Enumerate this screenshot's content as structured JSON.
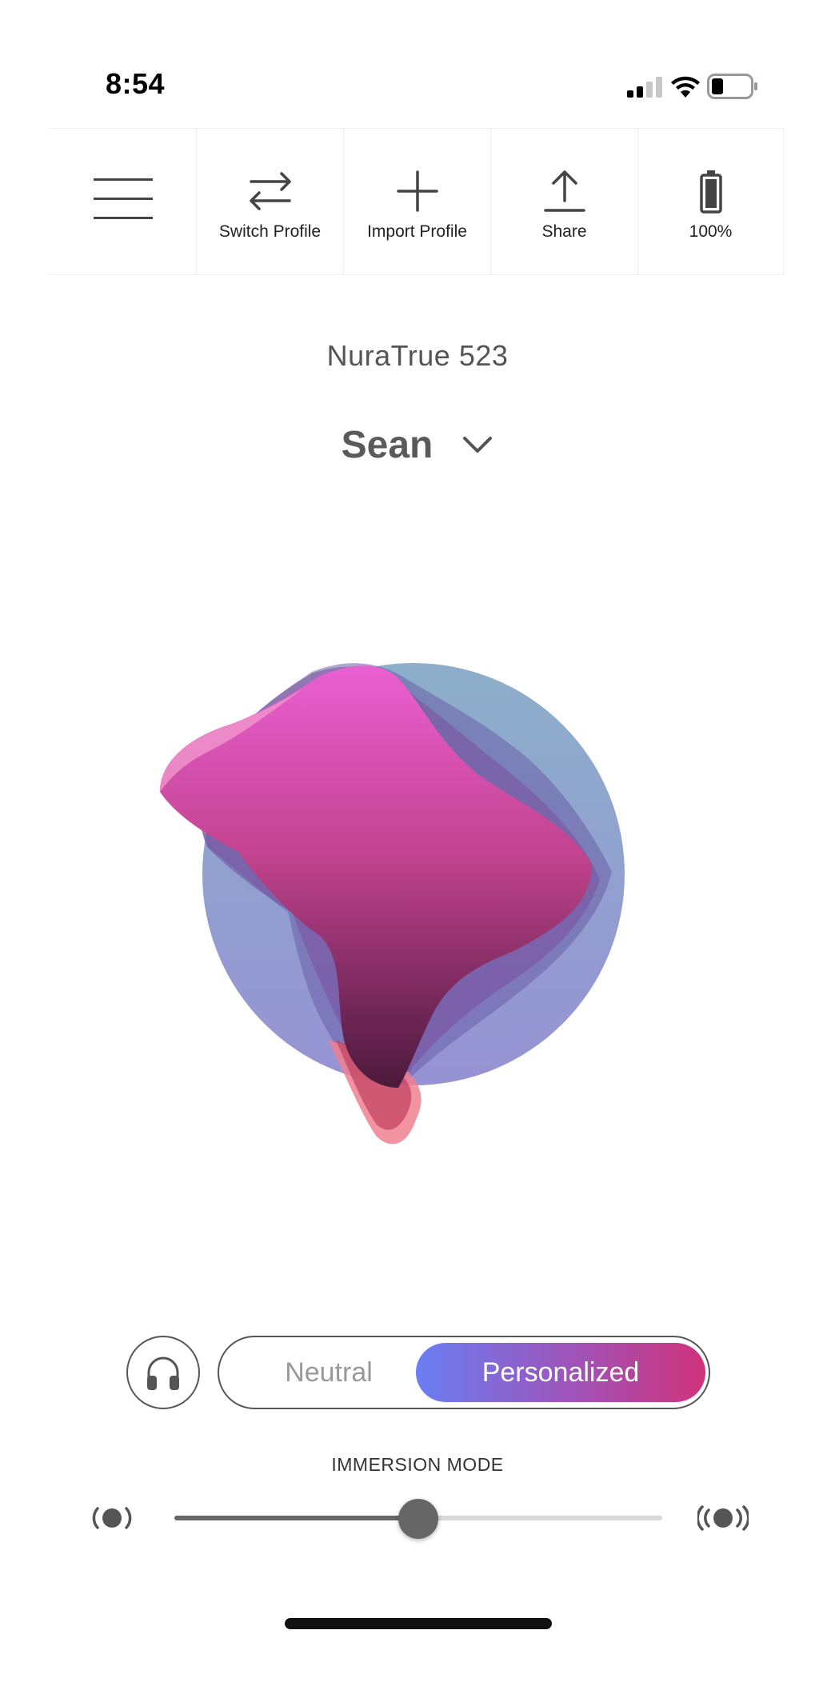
{
  "status_bar": {
    "time": "8:54",
    "signal_icon": "cellular-signal-icon",
    "wifi_icon": "wifi-icon",
    "battery_icon": "battery-icon"
  },
  "toolbar": {
    "menu_icon": "hamburger-menu-icon",
    "items": [
      {
        "label": "Switch Profile",
        "icon": "switch-arrows-icon"
      },
      {
        "label": "Import Profile",
        "icon": "plus-icon"
      },
      {
        "label": "Share",
        "icon": "share-upload-icon"
      },
      {
        "label": "100%",
        "icon": "battery-full-icon"
      }
    ]
  },
  "device_name": "NuraTrue 523",
  "profile": {
    "name": "Sean",
    "dropdown_icon": "chevron-down-icon"
  },
  "mode": {
    "headphone_icon": "headphones-icon",
    "options": [
      "Neutral",
      "Personalized"
    ],
    "selected": "Personalized"
  },
  "immersion": {
    "label": "IMMERSION MODE",
    "level": 0.5,
    "min_icon": "immersion-low-icon",
    "max_icon": "immersion-high-icon"
  },
  "colors": {
    "accent_start": "#6a7ef3",
    "accent_end": "#d0337a",
    "blob_pink": "#e35bc3",
    "blob_blue": "#7e9fc2"
  }
}
